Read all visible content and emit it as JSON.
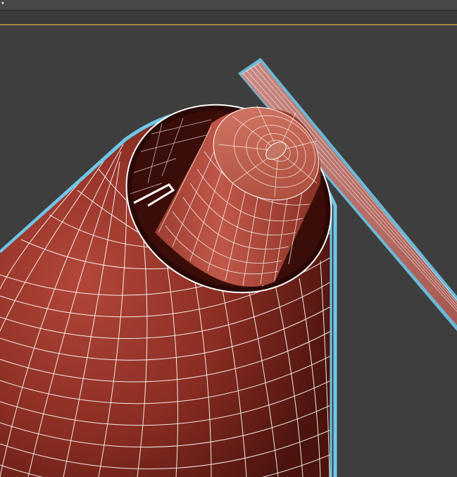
{
  "toolbar": {
    "menu_arrow": "▾"
  },
  "viewport": {
    "background_color": "#3e3e3e",
    "objects": [
      {
        "name": "cone-lampshade",
        "color": "#9b3a2c",
        "wire_color": "#ffffff",
        "selected": true
      },
      {
        "name": "inner-cylinder",
        "color": "#a94a39",
        "wire_color": "#ffffff",
        "selected": true
      },
      {
        "name": "diagonal-rod",
        "color": "#b8706a",
        "wire_color": "#ffffff",
        "selected": true
      }
    ],
    "selection_outline_color": "#6fc7e8"
  }
}
